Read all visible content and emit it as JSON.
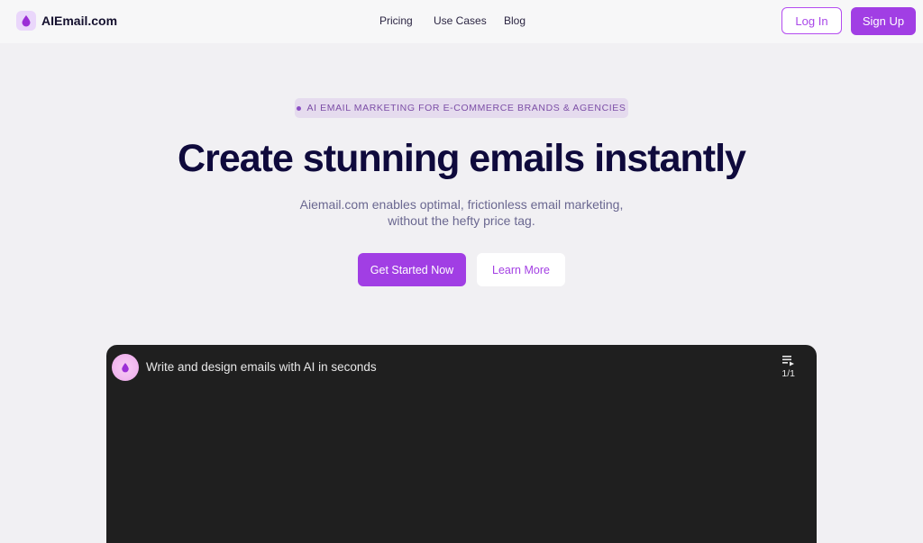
{
  "nav": {
    "brand": "AIEmail.com",
    "links": [
      "Pricing",
      "Use Cases",
      "Blog"
    ],
    "login_label": "Log In",
    "signup_label": "Sign Up"
  },
  "hero": {
    "eyebrow": "AI EMAIL MARKETING FOR E-COMMERCE BRANDS & AGENCIES",
    "headline": "Create stunning emails instantly",
    "subhead": "Aiemail.com enables optimal, frictionless email marketing, without the hefty price tag.",
    "primary_cta": "Get Started Now",
    "secondary_cta": "Learn More"
  },
  "video": {
    "title": "Write and design emails with AI in seconds",
    "playlist_count": "1/1"
  },
  "colors": {
    "accent": "#a13ee4",
    "headline": "#0f0a3c",
    "background": "#f1f0f3",
    "video_bg": "#1f1f1f"
  },
  "icons": {
    "logo": "droplet-icon",
    "video_avatar": "droplet-icon",
    "playlist": "playlist-icon"
  }
}
